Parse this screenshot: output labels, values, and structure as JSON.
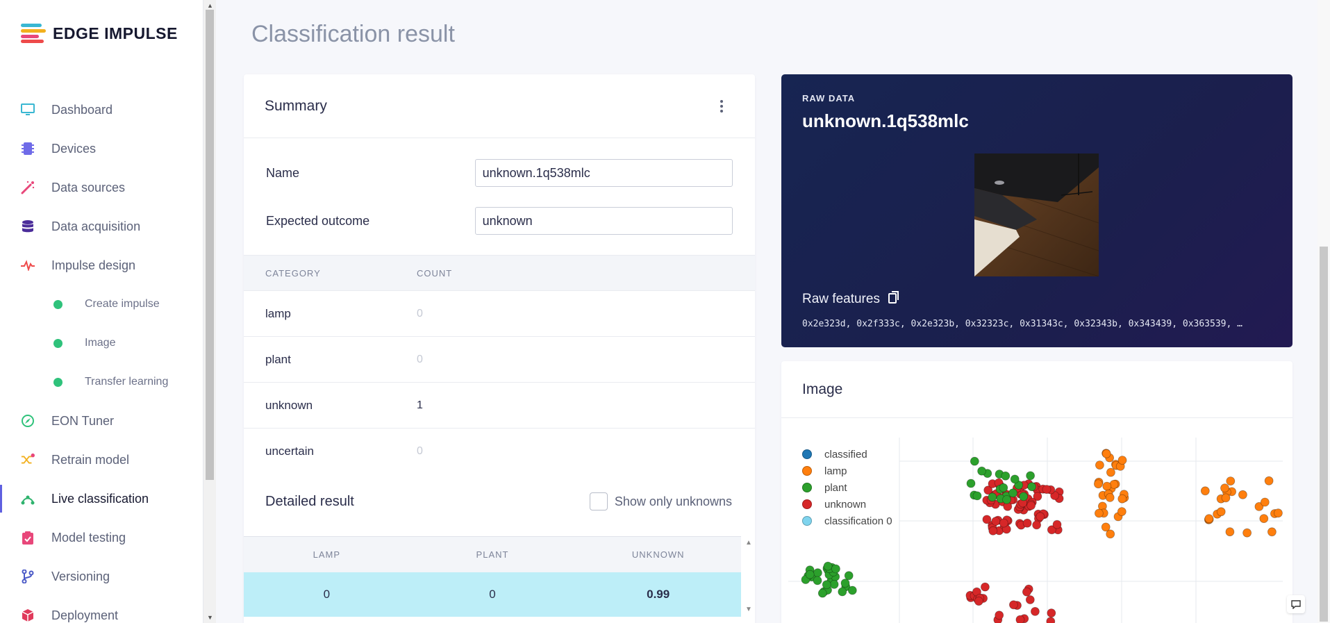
{
  "brand": {
    "name": "EDGE IMPULSE"
  },
  "sidebar": {
    "items": [
      {
        "label": "Dashboard",
        "icon": "monitor-icon",
        "color": "#39b7d2"
      },
      {
        "label": "Devices",
        "icon": "chip-icon",
        "color": "#6f6be8"
      },
      {
        "label": "Data sources",
        "icon": "magic-wand-icon",
        "color": "#e8477a"
      },
      {
        "label": "Data acquisition",
        "icon": "database-icon",
        "color": "#4b2d9a"
      },
      {
        "label": "Impulse design",
        "icon": "pulse-icon",
        "color": "#ee4a4a"
      },
      {
        "label": "Create impulse",
        "sub": true
      },
      {
        "label": "Image",
        "sub": true
      },
      {
        "label": "Transfer learning",
        "sub": true
      },
      {
        "label": "EON Tuner",
        "icon": "compass-icon",
        "color": "#2fc27b"
      },
      {
        "label": "Retrain model",
        "icon": "shuffle-icon",
        "color": "#f2b01e"
      },
      {
        "label": "Live classification",
        "icon": "network-icon",
        "color": "#2fb36e",
        "active": true
      },
      {
        "label": "Model testing",
        "icon": "clipboard-check-icon",
        "color": "#e8477a"
      },
      {
        "label": "Versioning",
        "icon": "branch-icon",
        "color": "#4b5ac7"
      },
      {
        "label": "Deployment",
        "icon": "box-icon",
        "color": "#e03a5b"
      }
    ]
  },
  "page": {
    "title": "Classification result"
  },
  "summary": {
    "title": "Summary",
    "name_label": "Name",
    "name_value": "unknown.1q538mlc",
    "expected_label": "Expected outcome",
    "expected_value": "unknown",
    "table_headers": [
      "CATEGORY",
      "COUNT"
    ],
    "rows": [
      {
        "category": "lamp",
        "count": "0"
      },
      {
        "category": "plant",
        "count": "0"
      },
      {
        "category": "unknown",
        "count": "1"
      },
      {
        "category": "uncertain",
        "count": "0"
      }
    ],
    "detailed_title": "Detailed result",
    "show_unknowns_label": "Show only unknowns",
    "result_headers": [
      "LAMP",
      "PLANT",
      "UNKNOWN"
    ],
    "result_row": [
      "0",
      "0",
      "0.99"
    ]
  },
  "raw": {
    "label": "RAW DATA",
    "title": "unknown.1q538mlc",
    "features_title": "Raw features",
    "features_values": "0x2e323d, 0x2f333c, 0x2e323b, 0x32323c, 0x31343c, 0x32343b, 0x343439, 0x363539, …"
  },
  "image_card": {
    "title": "Image",
    "legend": [
      {
        "name": "classified",
        "color": "#1f77b4"
      },
      {
        "name": "lamp",
        "color": "#ff7f0e"
      },
      {
        "name": "plant",
        "color": "#2ca02c"
      },
      {
        "name": "unknown",
        "color": "#d62728"
      },
      {
        "name": "classification 0",
        "color": "#7fd4ee"
      }
    ]
  }
}
